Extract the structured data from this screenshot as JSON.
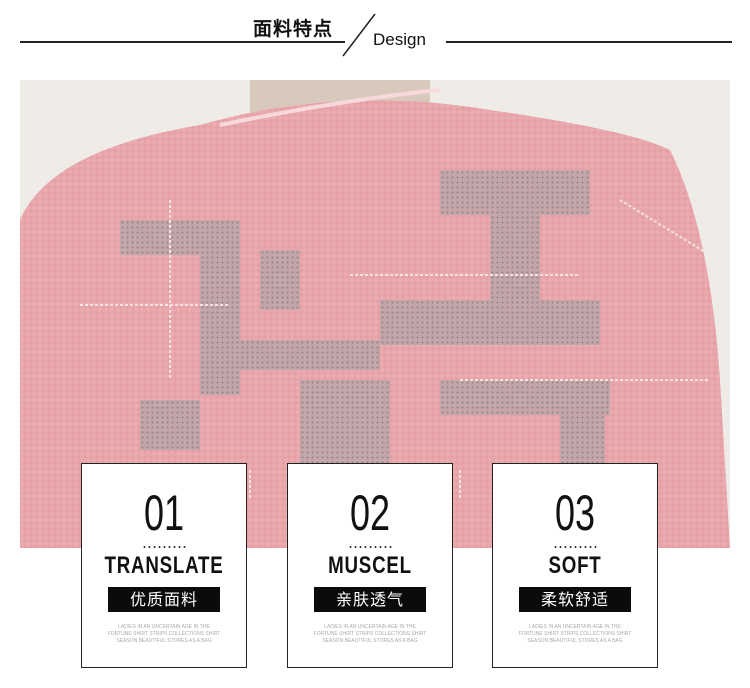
{
  "header": {
    "title_cn": "面料特点",
    "title_en": "Design"
  },
  "colors": {
    "sweater_pink": "#e9a9ae",
    "background": "#efece8",
    "tag_bg": "#0b0b0b"
  },
  "cards": [
    {
      "number": "01",
      "title": "TRANSLATE",
      "tag": "优质面料",
      "tiny_text": "LADIES IN AN UNCERTAIN AGE IN THE FORTUNE SHIRT STRIPS COLLECTIONS SHIRT SEASON BEAUTIFUL STORES AS A BAG"
    },
    {
      "number": "02",
      "title": "MUSCEL",
      "tag": "亲肤透气",
      "tiny_text": "LADIES IN AN UNCERTAIN AGE IN THE FORTUNE SHIRT STRIPS COLLECTIONS SHIRT SEASON BEAUTIFUL STORES AS A BAG"
    },
    {
      "number": "03",
      "title": "SOFT",
      "tag": "柔软舒适",
      "tiny_text": "LADIES IN AN UNCERTAIN AGE IN THE FORTUNE SHIRT STRIPS COLLECTIONS SHIRT SEASON BEAUTIFUL STORES AS A BAG"
    }
  ]
}
